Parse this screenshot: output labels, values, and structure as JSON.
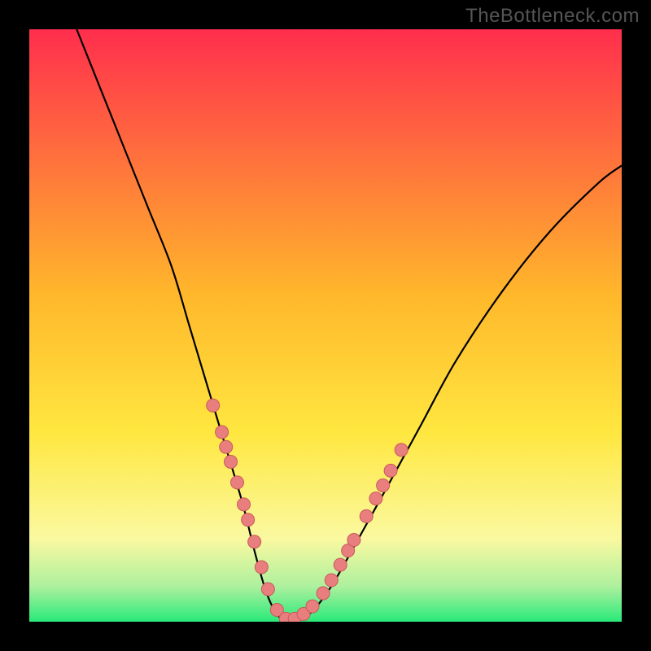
{
  "watermark": "TheBottleneck.com",
  "colors": {
    "frame_bg": "#000000",
    "watermark_color": "#555555",
    "curve_color": "#000000",
    "dot_fill": "#e97e7e",
    "dot_stroke": "#c75a5a",
    "gradient_top": "#ff2e4d",
    "gradient_mid_upper": "#ffb82b",
    "gradient_mid": "#ffe740",
    "gradient_mid_lower": "#faf9a0",
    "gradient_green_pale": "#aef09e",
    "gradient_bottom": "#29ea7a"
  },
  "chart_data": {
    "type": "line",
    "title": "",
    "xlabel": "",
    "ylabel": "",
    "xlim": [
      0,
      100
    ],
    "ylim": [
      0,
      100
    ],
    "background": "vertical_gradient_red_to_green",
    "curve": {
      "description": "V-shaped bottleneck curve; minimum near x≈43 at y≈0",
      "points_xy": [
        [
          8,
          100
        ],
        [
          12,
          90
        ],
        [
          16,
          80
        ],
        [
          20,
          70
        ],
        [
          24,
          60
        ],
        [
          27,
          50
        ],
        [
          30,
          40
        ],
        [
          33,
          30
        ],
        [
          36,
          20
        ],
        [
          38,
          12
        ],
        [
          40,
          5
        ],
        [
          42,
          1
        ],
        [
          44,
          0
        ],
        [
          46,
          0.5
        ],
        [
          48,
          2
        ],
        [
          51,
          6
        ],
        [
          55,
          13
        ],
        [
          60,
          22
        ],
        [
          66,
          33
        ],
        [
          72,
          44
        ],
        [
          80,
          56
        ],
        [
          88,
          66
        ],
        [
          96,
          74
        ],
        [
          100,
          77
        ]
      ]
    },
    "nearby_gpu_dots": {
      "description": "Scatter dots of nearby GPU matches clustered along the curve near the minimum",
      "points_xy": [
        [
          31.0,
          36.5
        ],
        [
          32.5,
          32.0
        ],
        [
          33.2,
          29.5
        ],
        [
          34.0,
          27.0
        ],
        [
          35.1,
          23.5
        ],
        [
          36.2,
          19.8
        ],
        [
          36.9,
          17.2
        ],
        [
          38.0,
          13.5
        ],
        [
          39.2,
          9.2
        ],
        [
          40.3,
          5.5
        ],
        [
          41.8,
          2.0
        ],
        [
          43.3,
          0.5
        ],
        [
          44.8,
          0.5
        ],
        [
          46.3,
          1.3
        ],
        [
          47.8,
          2.6
        ],
        [
          49.6,
          4.8
        ],
        [
          51.0,
          7.0
        ],
        [
          52.5,
          9.6
        ],
        [
          53.8,
          12.0
        ],
        [
          54.8,
          13.8
        ],
        [
          56.9,
          17.8
        ],
        [
          58.5,
          20.8
        ],
        [
          59.7,
          23.0
        ],
        [
          61.0,
          25.5
        ],
        [
          62.8,
          29.0
        ]
      ]
    }
  }
}
